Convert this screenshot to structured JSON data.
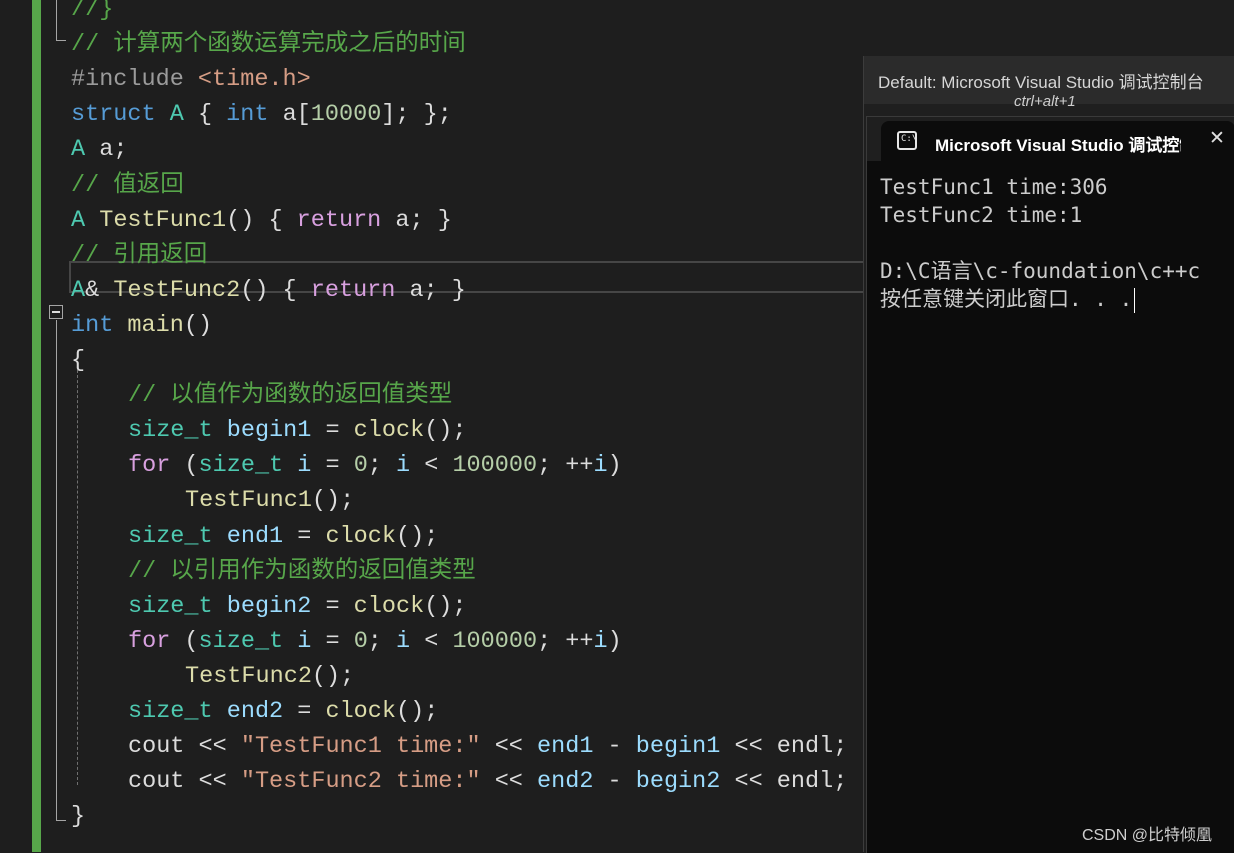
{
  "editor": {
    "lines": [
      {
        "text": "//}",
        "indent": 0,
        "tokens": [
          {
            "t": "//}",
            "c": "cm"
          }
        ]
      },
      {
        "text": "// 计算两个函数运算完成之后的时间",
        "indent": 0,
        "tokens": [
          {
            "t": "// 计算两个函数运算完成之后的时间",
            "c": "cm"
          }
        ]
      },
      {
        "text": "#include <time.h>",
        "indent": 0,
        "tokens": [
          {
            "t": "#include ",
            "c": "pp"
          },
          {
            "t": "<time.h>",
            "c": "st"
          }
        ]
      },
      {
        "text": "struct A { int a[10000]; };",
        "indent": 0,
        "tokens": [
          {
            "t": "struct",
            "c": "kw"
          },
          {
            "t": " ",
            "c": "ink"
          },
          {
            "t": "A",
            "c": "ty"
          },
          {
            "t": " { ",
            "c": "ink"
          },
          {
            "t": "int",
            "c": "kw"
          },
          {
            "t": " a[",
            "c": "ink"
          },
          {
            "t": "10000",
            "c": "nm"
          },
          {
            "t": "]; };",
            "c": "ink"
          }
        ]
      },
      {
        "text": "A a;",
        "indent": 0,
        "tokens": [
          {
            "t": "A",
            "c": "ty"
          },
          {
            "t": " a;",
            "c": "ink"
          }
        ]
      },
      {
        "text": "// 值返回",
        "indent": 0,
        "tokens": [
          {
            "t": "// 值返回",
            "c": "cm"
          }
        ]
      },
      {
        "text": "A TestFunc1() { return a; }",
        "indent": 0,
        "tokens": [
          {
            "t": "A",
            "c": "ty"
          },
          {
            "t": " ",
            "c": "ink"
          },
          {
            "t": "TestFunc1",
            "c": "fn"
          },
          {
            "t": "() { ",
            "c": "ink"
          },
          {
            "t": "return",
            "c": "pk"
          },
          {
            "t": " a; }",
            "c": "ink"
          }
        ]
      },
      {
        "text": "// 引用返回",
        "indent": 0,
        "tokens": [
          {
            "t": "// 引用返回",
            "c": "cm"
          }
        ]
      },
      {
        "text": "A& TestFunc2() { return a; }",
        "indent": 0,
        "tokens": [
          {
            "t": "A",
            "c": "ty"
          },
          {
            "t": "& ",
            "c": "ink"
          },
          {
            "t": "TestFunc2",
            "c": "fn"
          },
          {
            "t": "() { ",
            "c": "ink"
          },
          {
            "t": "return",
            "c": "pk"
          },
          {
            "t": " a; }",
            "c": "ink"
          }
        ]
      },
      {
        "text": "int main()",
        "indent": 0,
        "tokens": [
          {
            "t": "int",
            "c": "kw"
          },
          {
            "t": " ",
            "c": "ink"
          },
          {
            "t": "main",
            "c": "fn"
          },
          {
            "t": "()",
            "c": "ink"
          }
        ]
      },
      {
        "text": "{",
        "indent": 0,
        "tokens": [
          {
            "t": "{",
            "c": "ink"
          }
        ]
      },
      {
        "text": "// 以值作为函数的返回值类型",
        "indent": 1,
        "tokens": [
          {
            "t": "// 以值作为函数的返回值类型",
            "c": "cm"
          }
        ]
      },
      {
        "text": "size_t begin1 = clock();",
        "indent": 1,
        "tokens": [
          {
            "t": "size_t",
            "c": "ty"
          },
          {
            "t": " ",
            "c": "ink"
          },
          {
            "t": "begin1",
            "c": "vr"
          },
          {
            "t": " = ",
            "c": "ink"
          },
          {
            "t": "clock",
            "c": "fn"
          },
          {
            "t": "();",
            "c": "ink"
          }
        ]
      },
      {
        "text": "for (size_t i = 0; i < 100000; ++i)",
        "indent": 1,
        "tokens": [
          {
            "t": "for",
            "c": "pk"
          },
          {
            "t": " (",
            "c": "ink"
          },
          {
            "t": "size_t",
            "c": "ty"
          },
          {
            "t": " ",
            "c": "ink"
          },
          {
            "t": "i",
            "c": "vr"
          },
          {
            "t": " = ",
            "c": "ink"
          },
          {
            "t": "0",
            "c": "nm"
          },
          {
            "t": "; ",
            "c": "ink"
          },
          {
            "t": "i",
            "c": "vr"
          },
          {
            "t": " < ",
            "c": "ink"
          },
          {
            "t": "100000",
            "c": "nm"
          },
          {
            "t": "; ++",
            "c": "ink"
          },
          {
            "t": "i",
            "c": "vr"
          },
          {
            "t": ")",
            "c": "ink"
          }
        ]
      },
      {
        "text": "TestFunc1();",
        "indent": 2,
        "tokens": [
          {
            "t": "TestFunc1",
            "c": "fn"
          },
          {
            "t": "();",
            "c": "ink"
          }
        ]
      },
      {
        "text": "size_t end1 = clock();",
        "indent": 1,
        "tokens": [
          {
            "t": "size_t",
            "c": "ty"
          },
          {
            "t": " ",
            "c": "ink"
          },
          {
            "t": "end1",
            "c": "vr"
          },
          {
            "t": " = ",
            "c": "ink"
          },
          {
            "t": "clock",
            "c": "fn"
          },
          {
            "t": "();",
            "c": "ink"
          }
        ]
      },
      {
        "text": "// 以引用作为函数的返回值类型",
        "indent": 1,
        "tokens": [
          {
            "t": "// 以引用作为函数的返回值类型",
            "c": "cm"
          }
        ]
      },
      {
        "text": "size_t begin2 = clock();",
        "indent": 1,
        "tokens": [
          {
            "t": "size_t",
            "c": "ty"
          },
          {
            "t": " ",
            "c": "ink"
          },
          {
            "t": "begin2",
            "c": "vr"
          },
          {
            "t": " = ",
            "c": "ink"
          },
          {
            "t": "clock",
            "c": "fn"
          },
          {
            "t": "();",
            "c": "ink"
          }
        ]
      },
      {
        "text": "for (size_t i = 0; i < 100000; ++i)",
        "indent": 1,
        "tokens": [
          {
            "t": "for",
            "c": "pk"
          },
          {
            "t": " (",
            "c": "ink"
          },
          {
            "t": "size_t",
            "c": "ty"
          },
          {
            "t": " ",
            "c": "ink"
          },
          {
            "t": "i",
            "c": "vr"
          },
          {
            "t": " = ",
            "c": "ink"
          },
          {
            "t": "0",
            "c": "nm"
          },
          {
            "t": "; ",
            "c": "ink"
          },
          {
            "t": "i",
            "c": "vr"
          },
          {
            "t": " < ",
            "c": "ink"
          },
          {
            "t": "100000",
            "c": "nm"
          },
          {
            "t": "; ++",
            "c": "ink"
          },
          {
            "t": "i",
            "c": "vr"
          },
          {
            "t": ")",
            "c": "ink"
          }
        ]
      },
      {
        "text": "TestFunc2();",
        "indent": 2,
        "tokens": [
          {
            "t": "TestFunc2",
            "c": "fn"
          },
          {
            "t": "();",
            "c": "ink"
          }
        ]
      },
      {
        "text": "size_t end2 = clock();",
        "indent": 1,
        "tokens": [
          {
            "t": "size_t",
            "c": "ty"
          },
          {
            "t": " ",
            "c": "ink"
          },
          {
            "t": "end2",
            "c": "vr"
          },
          {
            "t": " = ",
            "c": "ink"
          },
          {
            "t": "clock",
            "c": "fn"
          },
          {
            "t": "();",
            "c": "ink"
          }
        ]
      },
      {
        "text": "cout << \"TestFunc1 time:\" << end1 - begin1 << endl;",
        "indent": 1,
        "tokens": [
          {
            "t": "cout",
            "c": "ink"
          },
          {
            "t": " << ",
            "c": "ink"
          },
          {
            "t": "\"TestFunc1 time:\"",
            "c": "st"
          },
          {
            "t": " << ",
            "c": "ink"
          },
          {
            "t": "end1",
            "c": "vr"
          },
          {
            "t": " - ",
            "c": "ink"
          },
          {
            "t": "begin1",
            "c": "vr"
          },
          {
            "t": " << ",
            "c": "ink"
          },
          {
            "t": "endl",
            "c": "ink"
          },
          {
            "t": ";",
            "c": "ink"
          }
        ]
      },
      {
        "text": "cout << \"TestFunc2 time:\" << end2 - begin2 << endl;",
        "indent": 1,
        "tokens": [
          {
            "t": "cout",
            "c": "ink"
          },
          {
            "t": " << ",
            "c": "ink"
          },
          {
            "t": "\"TestFunc2 time:\"",
            "c": "st"
          },
          {
            "t": " << ",
            "c": "ink"
          },
          {
            "t": "end2",
            "c": "vr"
          },
          {
            "t": " - ",
            "c": "ink"
          },
          {
            "t": "begin2",
            "c": "vr"
          },
          {
            "t": " << ",
            "c": "ink"
          },
          {
            "t": "endl",
            "c": "ink"
          },
          {
            "t": ";",
            "c": "ink"
          }
        ]
      },
      {
        "text": "}",
        "indent": 0,
        "tokens": [
          {
            "t": "}",
            "c": "ink"
          }
        ]
      }
    ]
  },
  "tool_window": {
    "title": "Default: Microsoft Visual Studio 调试控制台",
    "shortcut": "ctrl+alt+1"
  },
  "console": {
    "tab_title": "Microsoft Visual Studio 调试控制台",
    "tab_icon": "terminal-icon",
    "close_icon": "close-icon",
    "output": [
      "TestFunc1 time:306",
      "TestFunc2 time:1",
      "",
      "D:\\C语言\\c-foundation\\c++c",
      "按任意键关闭此窗口. . ."
    ]
  },
  "watermark": "CSDN @比特倾凰",
  "colors": {
    "background": "#1e1e1e",
    "change_bar": "#57a64a",
    "comment": "#57a64a",
    "keyword": "#569cd6",
    "type": "#4ec9b0",
    "function": "#dcdcaa",
    "variable": "#9cdcfe",
    "number": "#b5cea8",
    "string": "#d69d85",
    "control": "#d8a0df",
    "console_bg": "#0c0c0c"
  }
}
